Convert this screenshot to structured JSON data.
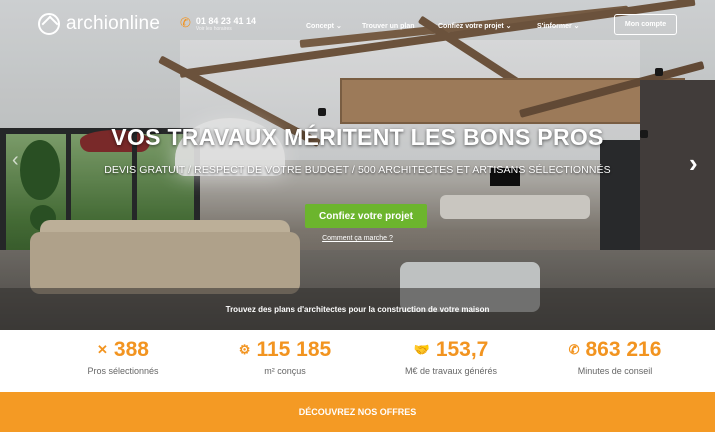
{
  "header": {
    "logo_text": "archionline",
    "phone_number": "01 84 23 41 14",
    "phone_subtext": "Voir les horaires",
    "nav": [
      {
        "label": "Concept ⌄"
      },
      {
        "label": "Trouver un plan"
      },
      {
        "label": "Confiez votre projet ⌄"
      },
      {
        "label": "S'informer ⌄"
      }
    ],
    "account_label": "Mon compte"
  },
  "hero": {
    "title": "VOS TRAVAUX MÉRITENT LES BONS PROS",
    "subtitle": "DEVIS GRATUIT / RESPECT DE VOTRE BUDGET / 500 ARCHITECTES ET ARTISANS SÉLECTIONNÉS",
    "cta_label": "Confiez votre projet",
    "how_label": "Comment ça marche ?",
    "plans_text": "Trouvez des plans d'architectes pour la construction de votre maison"
  },
  "stats": [
    {
      "icon": "✕",
      "value": "388",
      "label": "Pros sélectionnés"
    },
    {
      "icon": "⚙",
      "value": "115 185",
      "label": "m² conçus"
    },
    {
      "icon": "🤝",
      "value": "153,7",
      "label": "M€ de travaux générés"
    },
    {
      "icon": "✆",
      "value": "863 216",
      "label": "Minutes de conseil"
    }
  ],
  "offers_label": "DÉCOUVREZ NOS OFFRES",
  "colors": {
    "accent_orange": "#f49a24",
    "cta_green": "#6cb52d"
  }
}
